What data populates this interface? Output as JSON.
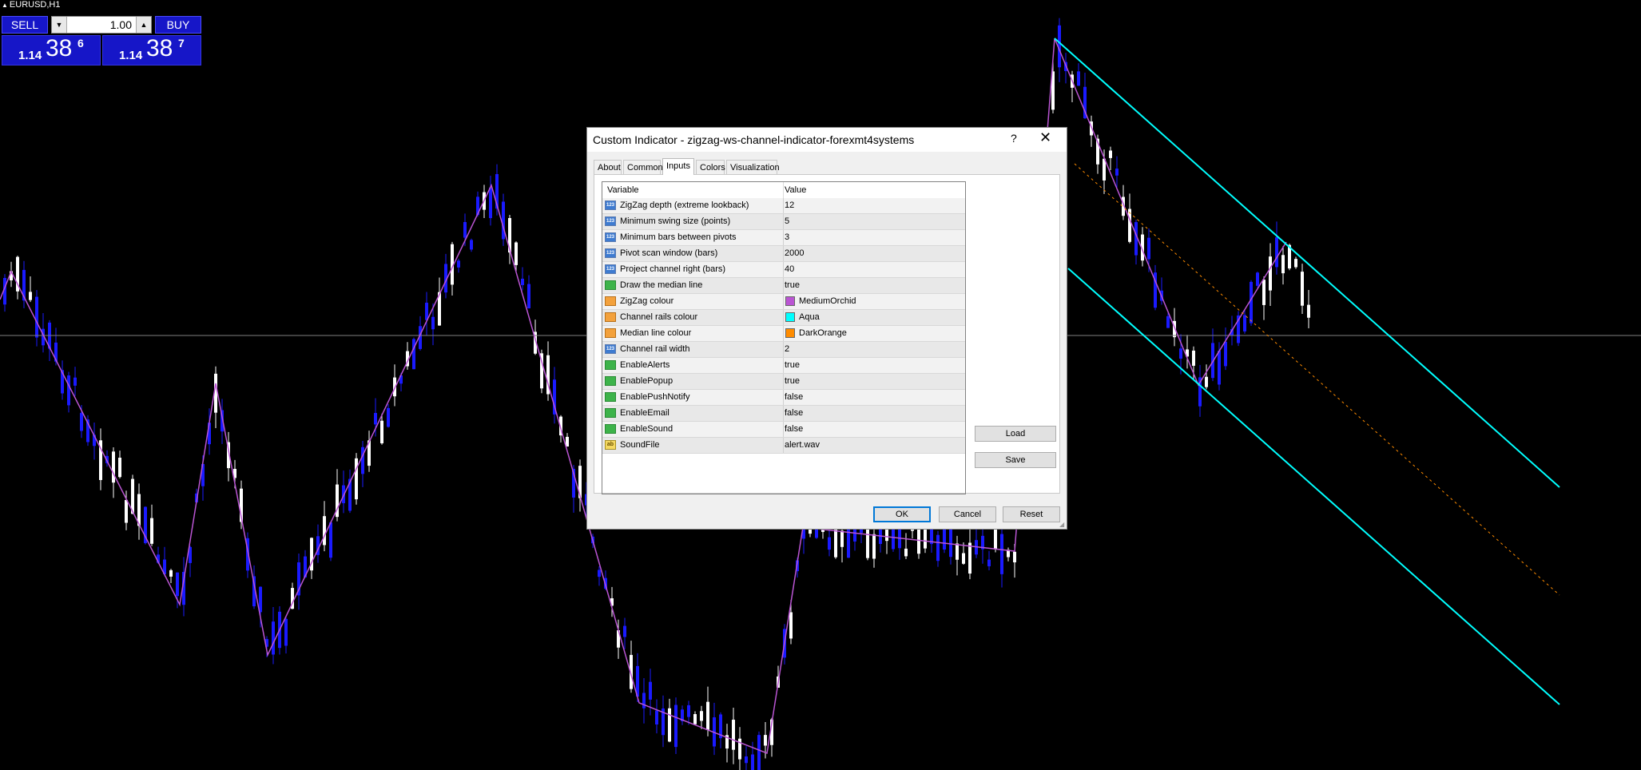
{
  "symbol": "EURUSD,H1",
  "trade_panel": {
    "sell_label": "SELL",
    "buy_label": "BUY",
    "volume": "1.00",
    "bid": {
      "small": "1.14",
      "big": "38",
      "pip": "6"
    },
    "ask": {
      "small": "1.14",
      "big": "38",
      "pip": "7"
    }
  },
  "dialog": {
    "title": "Custom Indicator - zigzag-ws-channel-indicator-forexmt4systems",
    "help_label": "?",
    "close_label": "✕",
    "tabs": [
      "About",
      "Common",
      "Inputs",
      "Colors",
      "Visualization"
    ],
    "active_tab": "Inputs",
    "columns": {
      "variable": "Variable",
      "value": "Value"
    },
    "rows": [
      {
        "icon": "123",
        "type": "int",
        "name": "ZigZag depth (extreme lookback)",
        "value": "12"
      },
      {
        "icon": "123",
        "type": "int",
        "name": "Minimum swing size (points)",
        "value": "5"
      },
      {
        "icon": "123",
        "type": "int",
        "name": "Minimum bars between pivots",
        "value": "3"
      },
      {
        "icon": "123",
        "type": "int",
        "name": "Pivot scan window (bars)",
        "value": "2000"
      },
      {
        "icon": "123",
        "type": "int",
        "name": "Project channel right (bars)",
        "value": "40"
      },
      {
        "icon": "bool",
        "type": "bool",
        "name": "Draw the median line",
        "value": "true"
      },
      {
        "icon": "color",
        "type": "color",
        "name": "ZigZag colour",
        "value": "MediumOrchid",
        "swatch": "#ba55d3"
      },
      {
        "icon": "color",
        "type": "color",
        "name": "Channel rails colour",
        "value": "Aqua",
        "swatch": "#00ffff"
      },
      {
        "icon": "color",
        "type": "color",
        "name": "Median line colour",
        "value": "DarkOrange",
        "swatch": "#ff8c00"
      },
      {
        "icon": "123",
        "type": "int",
        "name": "Channel rail width",
        "value": "2"
      },
      {
        "icon": "bool",
        "type": "bool",
        "name": "EnableAlerts",
        "value": "true"
      },
      {
        "icon": "bool",
        "type": "bool",
        "name": "EnablePopup",
        "value": "true"
      },
      {
        "icon": "bool",
        "type": "bool",
        "name": "EnablePushNotify",
        "value": "false"
      },
      {
        "icon": "bool",
        "type": "bool",
        "name": "EnableEmail",
        "value": "false"
      },
      {
        "icon": "bool",
        "type": "bool",
        "name": "EnableSound",
        "value": "false"
      },
      {
        "icon": "ab",
        "type": "string",
        "name": "SoundFile",
        "value": "alert.wav"
      }
    ],
    "buttons": {
      "load": "Load",
      "save": "Save",
      "ok": "OK",
      "cancel": "Cancel",
      "reset": "Reset"
    }
  },
  "chart_colors": {
    "background": "#000000",
    "bull_candle": "#ffffff",
    "bear_candle": "#1a1aff",
    "zigzag": "#ba55d3",
    "channel_rails": "#00ffff",
    "median_line": "#ff8c00",
    "bid_line": "#808080"
  }
}
